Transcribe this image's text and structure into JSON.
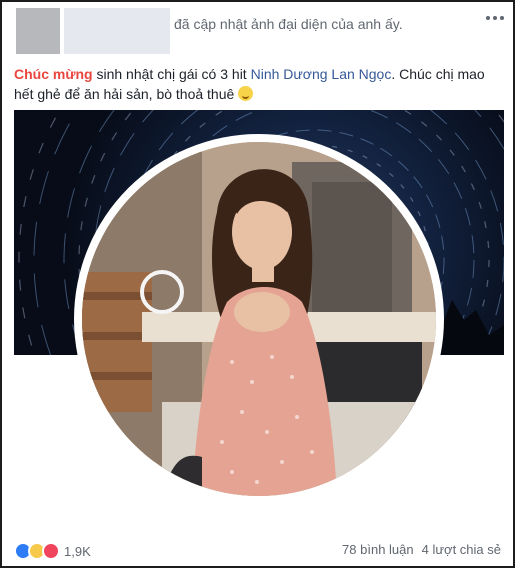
{
  "header": {
    "update_text": "đã cập nhật ảnh đại diện của anh ấy."
  },
  "post": {
    "tag1": "Chúc mừng",
    "text1": " sinh nhật chị gái có 3 hit ",
    "tag2": "Ninh Dương Lan Ngọc",
    "text2": ". Chúc chị mao hết ghẻ để ăn hải sản, bò thoả thuê "
  },
  "icons": {
    "more": "more-icon",
    "like": "like-reaction-icon",
    "haha": "haha-reaction-icon",
    "love": "love-reaction-icon"
  },
  "colors": {
    "tag_red": "#e9463f",
    "tag_blue": "#365899",
    "like_blue": "#2e7cf6"
  },
  "footer": {
    "reaction_count": "1,9K",
    "comments": "78 bình luận",
    "shares": "4 lượt chia sẻ"
  }
}
